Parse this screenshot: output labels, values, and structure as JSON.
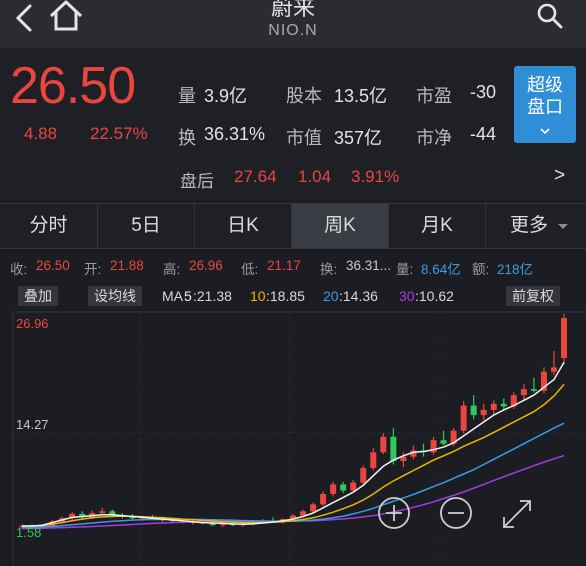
{
  "header": {
    "title": "蔚来",
    "code": "NIO.N"
  },
  "quote": {
    "price": "26.50",
    "change": "4.88",
    "change_pct": "22.57%",
    "stats": [
      {
        "label": "量",
        "value": "3.9亿"
      },
      {
        "label": "股本",
        "value": "13.5亿"
      },
      {
        "label": "市盈",
        "value": "-30"
      },
      {
        "label": "换",
        "value": "36.31%"
      },
      {
        "label": "市值",
        "value": "357亿"
      },
      {
        "label": "市净",
        "value": "-44"
      }
    ],
    "after_hours": {
      "label": "盘后",
      "price": "27.64",
      "change": "1.04",
      "change_pct": "3.91%"
    },
    "super_button": [
      "超级",
      "盘口"
    ],
    "arrow": ">"
  },
  "tabs": [
    "分时",
    "5日",
    "日K",
    "周K",
    "月K",
    "更多"
  ],
  "active_tab": "周K",
  "info_line": {
    "close_label": "收:",
    "close": "26.50",
    "open_label": "开:",
    "open": "21.88",
    "high_label": "高:",
    "high": "26.96",
    "low_label": "低:",
    "low": "21.17",
    "turnover_label": "换:",
    "turnover": "36.31...",
    "volume_label": "量:",
    "volume": "8.64亿",
    "amount_label": "额:",
    "amount": "218亿"
  },
  "ma_row": {
    "overlay": "叠加",
    "set_ma": "设均线",
    "ma_label": "MA",
    "ma5_key": "5",
    "ma5": ":21.38",
    "ma10_key": "10",
    "ma10": ":18.85",
    "ma20_key": "20",
    "ma20": ":14.36",
    "ma30_key": "30",
    "ma30": ":10.62",
    "adjust": "前复权"
  },
  "chart_data": {
    "type": "candlestick",
    "y_labels": [
      "26.96",
      "14.27",
      "1.58"
    ],
    "ylim": [
      1.58,
      26.96
    ],
    "colors": {
      "up": "#e9463f",
      "down": "#2ec95a",
      "ma5": "#f2f2f2",
      "ma10": "#f0b400",
      "ma20": "#3a9be8",
      "ma30": "#a83be0"
    },
    "candles": [
      {
        "o": 2.4,
        "h": 2.7,
        "l": 2.2,
        "c": 2.5
      },
      {
        "o": 2.5,
        "h": 2.7,
        "l": 2.3,
        "c": 2.35
      },
      {
        "o": 2.35,
        "h": 2.6,
        "l": 2.2,
        "c": 2.5
      },
      {
        "o": 2.5,
        "h": 3.2,
        "l": 2.4,
        "c": 3.0
      },
      {
        "o": 3.0,
        "h": 3.6,
        "l": 2.8,
        "c": 3.4
      },
      {
        "o": 3.4,
        "h": 4.1,
        "l": 3.2,
        "c": 3.9
      },
      {
        "o": 3.9,
        "h": 4.2,
        "l": 3.3,
        "c": 3.5
      },
      {
        "o": 3.5,
        "h": 4.3,
        "l": 3.3,
        "c": 4.0
      },
      {
        "o": 4.0,
        "h": 4.6,
        "l": 3.8,
        "c": 4.2
      },
      {
        "o": 4.2,
        "h": 4.4,
        "l": 3.6,
        "c": 3.7
      },
      {
        "o": 3.7,
        "h": 4.0,
        "l": 3.4,
        "c": 3.6
      },
      {
        "o": 3.6,
        "h": 3.9,
        "l": 3.3,
        "c": 3.4
      },
      {
        "o": 3.4,
        "h": 3.7,
        "l": 3.1,
        "c": 3.5
      },
      {
        "o": 3.5,
        "h": 3.8,
        "l": 3.2,
        "c": 3.3
      },
      {
        "o": 3.3,
        "h": 3.6,
        "l": 3.0,
        "c": 3.2
      },
      {
        "o": 3.2,
        "h": 3.5,
        "l": 2.9,
        "c": 3.1
      },
      {
        "o": 3.1,
        "h": 3.3,
        "l": 2.8,
        "c": 2.9
      },
      {
        "o": 2.9,
        "h": 3.2,
        "l": 2.7,
        "c": 3.0
      },
      {
        "o": 3.0,
        "h": 3.3,
        "l": 2.7,
        "c": 2.8
      },
      {
        "o": 2.8,
        "h": 3.0,
        "l": 2.5,
        "c": 2.6
      },
      {
        "o": 2.6,
        "h": 2.9,
        "l": 2.4,
        "c": 2.75
      },
      {
        "o": 2.75,
        "h": 3.0,
        "l": 2.5,
        "c": 2.6
      },
      {
        "o": 2.6,
        "h": 2.9,
        "l": 2.4,
        "c": 2.8
      },
      {
        "o": 2.8,
        "h": 3.1,
        "l": 2.6,
        "c": 2.95
      },
      {
        "o": 2.95,
        "h": 3.3,
        "l": 2.8,
        "c": 3.15
      },
      {
        "o": 3.15,
        "h": 3.5,
        "l": 2.9,
        "c": 3.0
      },
      {
        "o": 3.0,
        "h": 3.4,
        "l": 2.8,
        "c": 3.3
      },
      {
        "o": 3.3,
        "h": 3.9,
        "l": 3.1,
        "c": 3.7
      },
      {
        "o": 3.7,
        "h": 4.4,
        "l": 3.5,
        "c": 4.2
      },
      {
        "o": 4.2,
        "h": 5.2,
        "l": 4.0,
        "c": 5.0
      },
      {
        "o": 5.0,
        "h": 6.5,
        "l": 4.8,
        "c": 6.2
      },
      {
        "o": 6.2,
        "h": 7.6,
        "l": 5.9,
        "c": 7.3
      },
      {
        "o": 7.3,
        "h": 7.6,
        "l": 6.3,
        "c": 6.6
      },
      {
        "o": 6.6,
        "h": 7.8,
        "l": 6.4,
        "c": 7.5
      },
      {
        "o": 7.5,
        "h": 9.5,
        "l": 7.3,
        "c": 9.2
      },
      {
        "o": 9.2,
        "h": 11.5,
        "l": 8.9,
        "c": 11.0
      },
      {
        "o": 11.0,
        "h": 13.2,
        "l": 10.8,
        "c": 12.8
      },
      {
        "o": 12.8,
        "h": 13.8,
        "l": 9.6,
        "c": 10.0
      },
      {
        "o": 10.0,
        "h": 11.0,
        "l": 9.3,
        "c": 10.5
      },
      {
        "o": 10.5,
        "h": 11.8,
        "l": 10.2,
        "c": 11.2
      },
      {
        "o": 11.2,
        "h": 12.0,
        "l": 10.5,
        "c": 11.0
      },
      {
        "o": 11.0,
        "h": 12.8,
        "l": 10.7,
        "c": 12.4
      },
      {
        "o": 12.4,
        "h": 13.5,
        "l": 11.8,
        "c": 12.0
      },
      {
        "o": 12.0,
        "h": 13.8,
        "l": 11.7,
        "c": 13.5
      },
      {
        "o": 13.5,
        "h": 16.9,
        "l": 13.2,
        "c": 16.4
      },
      {
        "o": 16.4,
        "h": 17.6,
        "l": 14.8,
        "c": 15.3
      },
      {
        "o": 15.3,
        "h": 16.6,
        "l": 14.7,
        "c": 15.9
      },
      {
        "o": 15.9,
        "h": 17.0,
        "l": 15.2,
        "c": 16.6
      },
      {
        "o": 16.6,
        "h": 17.2,
        "l": 15.9,
        "c": 16.3
      },
      {
        "o": 16.3,
        "h": 18.0,
        "l": 16.0,
        "c": 17.6
      },
      {
        "o": 17.6,
        "h": 18.9,
        "l": 17.0,
        "c": 18.3
      },
      {
        "o": 18.3,
        "h": 19.6,
        "l": 17.9,
        "c": 18.1
      },
      {
        "o": 18.1,
        "h": 20.8,
        "l": 17.8,
        "c": 20.3
      },
      {
        "o": 20.3,
        "h": 22.7,
        "l": 19.9,
        "c": 20.8
      },
      {
        "o": 21.88,
        "h": 26.96,
        "l": 21.17,
        "c": 26.5
      }
    ],
    "ma5_path": [
      2.5,
      2.5,
      2.6,
      2.9,
      3.2,
      3.5,
      3.6,
      3.7,
      3.8,
      3.8,
      3.7,
      3.6,
      3.5,
      3.4,
      3.3,
      3.2,
      3.1,
      3.0,
      2.9,
      2.85,
      2.8,
      2.75,
      2.7,
      2.75,
      2.85,
      2.95,
      3.1,
      3.3,
      3.6,
      4.0,
      4.6,
      5.2,
      5.8,
      6.4,
      7.2,
      8.3,
      9.4,
      10.1,
      10.6,
      11.0,
      11.1,
      11.3,
      11.6,
      12.1,
      12.9,
      13.7,
      14.5,
      15.3,
      15.9,
      16.4,
      17.0,
      17.6,
      18.5,
      19.4,
      21.38
    ],
    "ma10_path": [
      2.5,
      2.5,
      2.55,
      2.7,
      2.9,
      3.1,
      3.3,
      3.45,
      3.55,
      3.6,
      3.65,
      3.62,
      3.58,
      3.52,
      3.45,
      3.38,
      3.3,
      3.22,
      3.15,
      3.08,
      3.0,
      2.95,
      2.9,
      2.9,
      2.9,
      2.95,
      3.0,
      3.1,
      3.25,
      3.45,
      3.75,
      4.1,
      4.5,
      4.95,
      5.5,
      6.2,
      7.0,
      7.7,
      8.3,
      8.9,
      9.5,
      10.1,
      10.6,
      11.1,
      11.7,
      12.2,
      12.7,
      13.3,
      13.9,
      14.5,
      15.1,
      15.7,
      16.5,
      17.5,
      18.85
    ],
    "ma20_path": [
      2.3,
      2.35,
      2.4,
      2.45,
      2.55,
      2.65,
      2.75,
      2.85,
      2.95,
      3.05,
      3.12,
      3.18,
      3.22,
      3.25,
      3.27,
      3.28,
      3.28,
      3.27,
      3.25,
      3.22,
      3.19,
      3.16,
      3.13,
      3.1,
      3.08,
      3.06,
      3.05,
      3.06,
      3.1,
      3.18,
      3.3,
      3.45,
      3.65,
      3.9,
      4.2,
      4.55,
      4.95,
      5.35,
      5.75,
      6.15,
      6.6,
      7.05,
      7.5,
      8.0,
      8.5,
      9.0,
      9.6,
      10.2,
      10.8,
      11.4,
      12.0,
      12.6,
      13.2,
      13.8,
      14.36
    ],
    "ma30_path": [
      2.2,
      2.22,
      2.25,
      2.28,
      2.32,
      2.36,
      2.4,
      2.45,
      2.5,
      2.56,
      2.62,
      2.68,
      2.74,
      2.8,
      2.85,
      2.9,
      2.94,
      2.98,
      3.0,
      3.02,
      3.04,
      3.05,
      3.06,
      3.06,
      3.06,
      3.06,
      3.06,
      3.07,
      3.09,
      3.12,
      3.17,
      3.24,
      3.32,
      3.42,
      3.55,
      3.7,
      3.9,
      4.12,
      4.38,
      4.66,
      4.96,
      5.3,
      5.66,
      6.04,
      6.44,
      6.86,
      7.3,
      7.74,
      8.18,
      8.62,
      9.04,
      9.46,
      9.86,
      10.25,
      10.62
    ]
  }
}
